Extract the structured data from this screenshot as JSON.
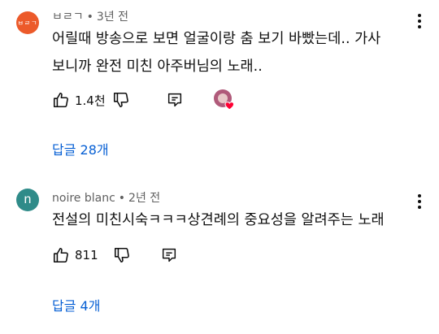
{
  "comments": [
    {
      "avatar_text": "ㅂㄹㄱ",
      "author": "ㅂㄹㄱ",
      "time": "3년 전",
      "text_lines": [
        "어릴때 방송으로 보면 얼굴이랑 춤 보기 바빴는데.. 가사",
        "보니까 완전 미친 아주버님의 노래.."
      ],
      "likes": "1.4천",
      "replies": "답글 28개",
      "has_creator_heart": true
    },
    {
      "avatar_text": "n",
      "author": "noire blanc",
      "time": "2년 전",
      "text_lines": [
        "전설의 미친시숙ㅋㅋㅋ상견례의 중요성을 알려주는 노래"
      ],
      "likes": "811",
      "replies": "답글 4개",
      "has_creator_heart": false
    }
  ],
  "colors": {
    "link": "#065fd4",
    "meta": "#606060",
    "heart": "#ff0033"
  },
  "icons": [
    "like-icon",
    "dislike-icon",
    "reply-icon",
    "more-vert-icon",
    "creator-heart-icon"
  ]
}
